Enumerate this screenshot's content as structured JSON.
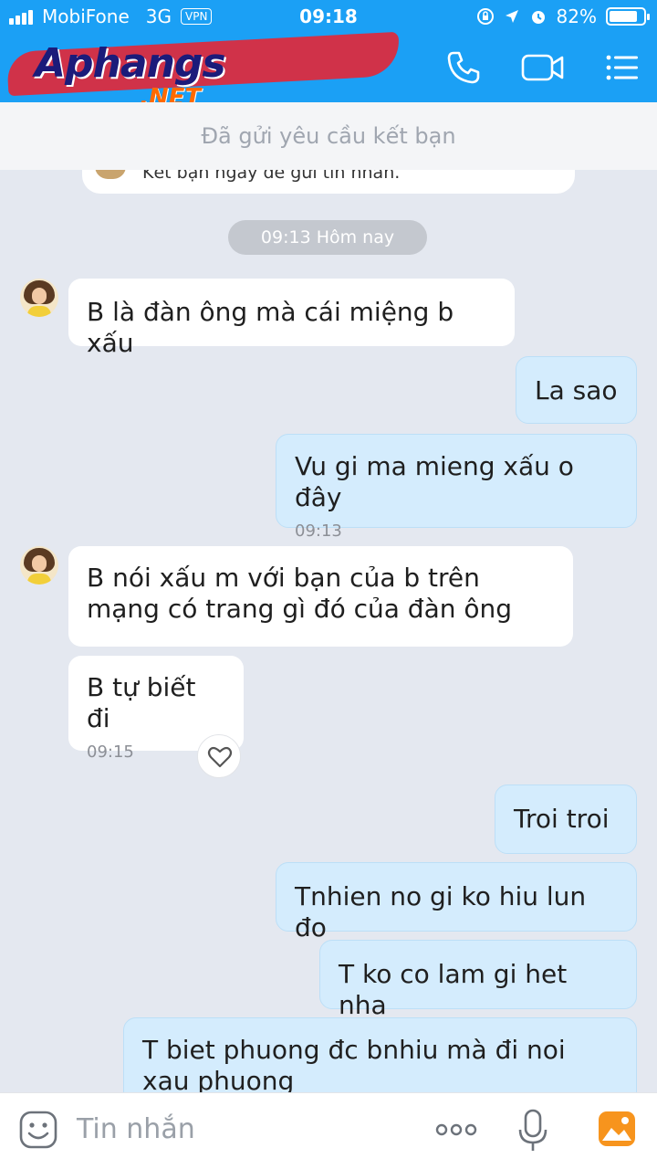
{
  "status": {
    "carrier": "MobiFone",
    "network": "3G",
    "vpn": "VPN",
    "time": "09:18",
    "battery": "82%",
    "battery_level": 0.82
  },
  "header": {
    "logo_text": "Aphangs",
    "logo_sub": ".NET",
    "icons": [
      "phone-icon",
      "video-camera-icon",
      "menu-icon"
    ]
  },
  "friend_request": {
    "banner": "Đã gửi yêu cầu kết bạn",
    "card_text": "Kết bạn ngay để gửi tin nhắn."
  },
  "date_pill": "09:13 Hôm nay",
  "messages": [
    {
      "dir": "in",
      "text": "B là đàn ông mà cái miệng b xấu"
    },
    {
      "dir": "out",
      "text": "La sao"
    },
    {
      "dir": "out",
      "text": "Vu gi ma mieng xấu o đây",
      "time": "09:13"
    },
    {
      "dir": "in",
      "text": "B nói xấu m với bạn của b trên mạng có trang  gì đó của đàn ông"
    },
    {
      "dir": "in",
      "text": "B tự biết đi",
      "time": "09:15"
    },
    {
      "dir": "out",
      "text": "Troi troi"
    },
    {
      "dir": "out",
      "text": "Tnhien no gi ko hiu lun đo"
    },
    {
      "dir": "out",
      "text": "T ko co lam gi het nha"
    },
    {
      "dir": "out",
      "text": "T biet phuong đc bnhiu mà đi noi xau phuong"
    }
  ],
  "composer": {
    "placeholder": "Tin nhắn",
    "icons": [
      "emoji-icon",
      "more-icon",
      "microphone-icon",
      "gallery-icon"
    ]
  },
  "colors": {
    "header": "#1ba0f5",
    "chat_bg": "#e4e8f0",
    "out_bubble": "#d4ecfd",
    "in_bubble": "#ffffff"
  }
}
